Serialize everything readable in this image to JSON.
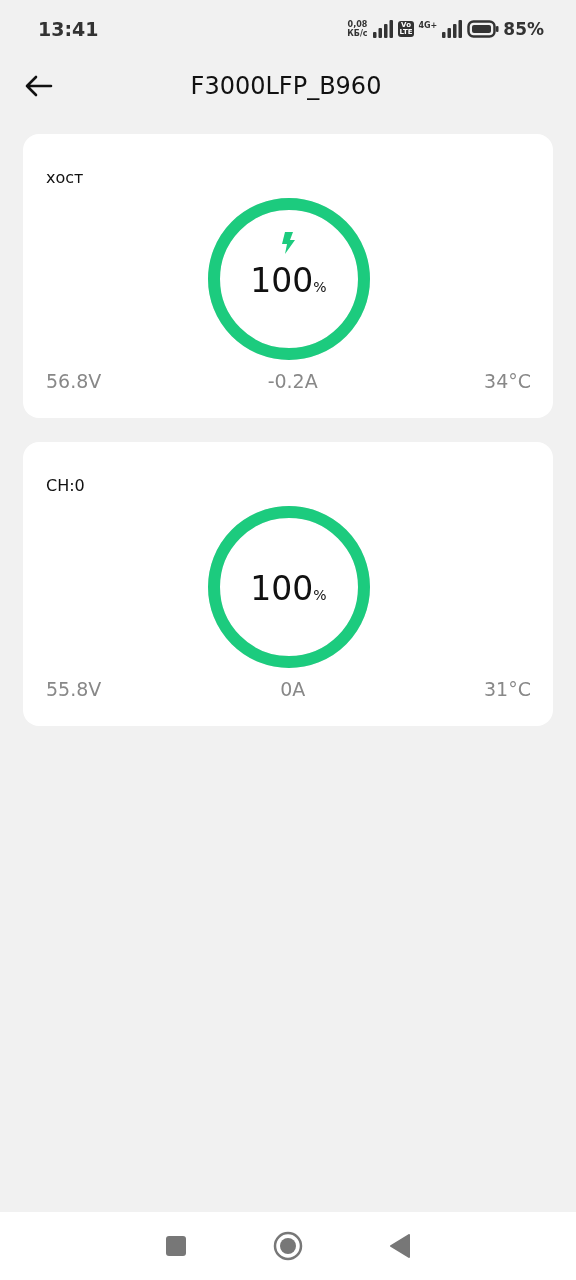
{
  "status_bar": {
    "time": "13:41",
    "speed_value": "0,08",
    "speed_unit": "КБ/с",
    "volte": "Vo\nLTE",
    "network": "4G+",
    "battery": "85%"
  },
  "header": {
    "title": "F3000LFP_B960"
  },
  "batteries": [
    {
      "name": "хост",
      "charging": true,
      "level": 1,
      "percent": "100",
      "percent_unit": "%",
      "voltage": "56.8V",
      "current": "-0.2A",
      "temperature": "34°C"
    },
    {
      "name": "CH:0",
      "charging": false,
      "level": 1,
      "percent": "100",
      "percent_unit": "%",
      "voltage": "55.8V",
      "current": "0A",
      "temperature": "31°C"
    }
  ]
}
